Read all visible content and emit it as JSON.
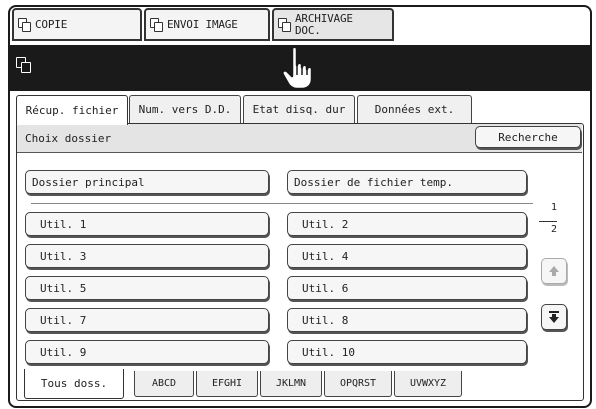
{
  "mode_tabs": [
    {
      "label": "COPIE",
      "icon": "copy-icon"
    },
    {
      "label": "ENVOI IMAGE",
      "icon": "send-image-icon"
    },
    {
      "label_line1": "ARCHIVAGE",
      "label_line2": "DOC.",
      "icon": "document-filing-icon"
    }
  ],
  "title_bar_icon": "document-filing-icon",
  "tabs": [
    "Récup. fichier",
    "Num. vers D.D.",
    "Etat disq. dur",
    "Données ext."
  ],
  "panel": {
    "title": "Choix dossier",
    "search_label": "Recherche"
  },
  "folders": {
    "main": "Dossier principal",
    "temp": "Dossier de fichier temp.",
    "users": [
      "Util. 1",
      "Util. 2",
      "Util. 3",
      "Util. 4",
      "Util. 5",
      "Util. 6",
      "Util. 7",
      "Util. 8",
      "Util. 9",
      "Util. 10"
    ]
  },
  "pager": {
    "current": "1",
    "total": "2"
  },
  "index_tabs": [
    "Tous doss.",
    "ABCD",
    "EFGHI",
    "JKLMN",
    "OPQRST",
    "UVWXYZ"
  ],
  "colors": {
    "bar": "#1a1a1a",
    "header": "#e4e4e4",
    "button": "#f6f6f6"
  }
}
